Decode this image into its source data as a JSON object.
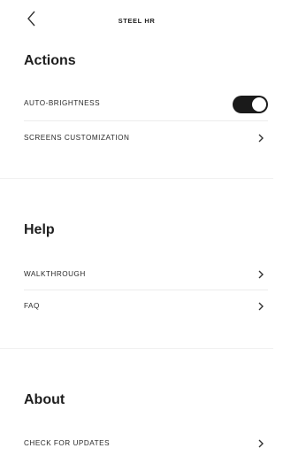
{
  "header": {
    "title": "STEEL HR"
  },
  "sections": {
    "actions": {
      "title": "Actions",
      "auto_brightness": {
        "label": "AUTO-BRIGHTNESS",
        "enabled": true
      },
      "screens_customization": {
        "label": "SCREENS CUSTOMIZATION"
      }
    },
    "help": {
      "title": "Help",
      "walkthrough": {
        "label": "WALKTHROUGH"
      },
      "faq": {
        "label": "FAQ"
      }
    },
    "about": {
      "title": "About",
      "check_updates": {
        "label": "CHECK FOR UPDATES"
      }
    }
  },
  "icons": {
    "back": "chevron-left-icon",
    "row_chevron": "chevron-right-icon"
  },
  "colors": {
    "toggle_on": "#1a1a1a",
    "divider": "#ececec",
    "text": "#222222"
  }
}
